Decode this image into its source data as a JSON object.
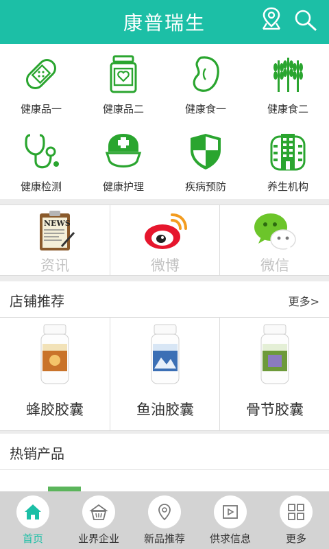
{
  "header": {
    "title": "康普瑞生"
  },
  "categories": [
    {
      "label": "健康品一",
      "icon": "bandage-icon"
    },
    {
      "label": "健康品二",
      "icon": "medicine-jar-icon"
    },
    {
      "label": "健康食一",
      "icon": "bean-icon"
    },
    {
      "label": "健康食二",
      "icon": "wheat-icon"
    },
    {
      "label": "健康检测",
      "icon": "stethoscope-icon"
    },
    {
      "label": "健康护理",
      "icon": "nurse-cap-icon"
    },
    {
      "label": "疾病预防",
      "icon": "shield-icon"
    },
    {
      "label": "养生机构",
      "icon": "building-icon"
    }
  ],
  "social": [
    {
      "label": "资讯",
      "icon": "news-clipboard-icon"
    },
    {
      "label": "微博",
      "icon": "weibo-icon"
    },
    {
      "label": "微信",
      "icon": "wechat-icon"
    }
  ],
  "shop": {
    "title": "店铺推荐",
    "more": "更多>",
    "products": [
      {
        "name": "蜂胶胶囊",
        "accent": "#c9732a"
      },
      {
        "name": "鱼油胶囊",
        "accent": "#3b6fb5"
      },
      {
        "name": "骨节胶囊",
        "accent": "#6d9a3a"
      }
    ]
  },
  "hot": {
    "title": "热销产品"
  },
  "tabs": [
    {
      "label": "首页",
      "icon": "home-icon",
      "active": true
    },
    {
      "label": "业界企业",
      "icon": "basket-icon",
      "active": false
    },
    {
      "label": "新品推荐",
      "icon": "location-pin-icon",
      "active": false
    },
    {
      "label": "供求信息",
      "icon": "play-video-icon",
      "active": false
    },
    {
      "label": "更多",
      "icon": "grid-icon",
      "active": false
    }
  ],
  "colors": {
    "brand": "#1cbfa6",
    "icon_green": "#2aa52f",
    "background": "#ececec"
  }
}
